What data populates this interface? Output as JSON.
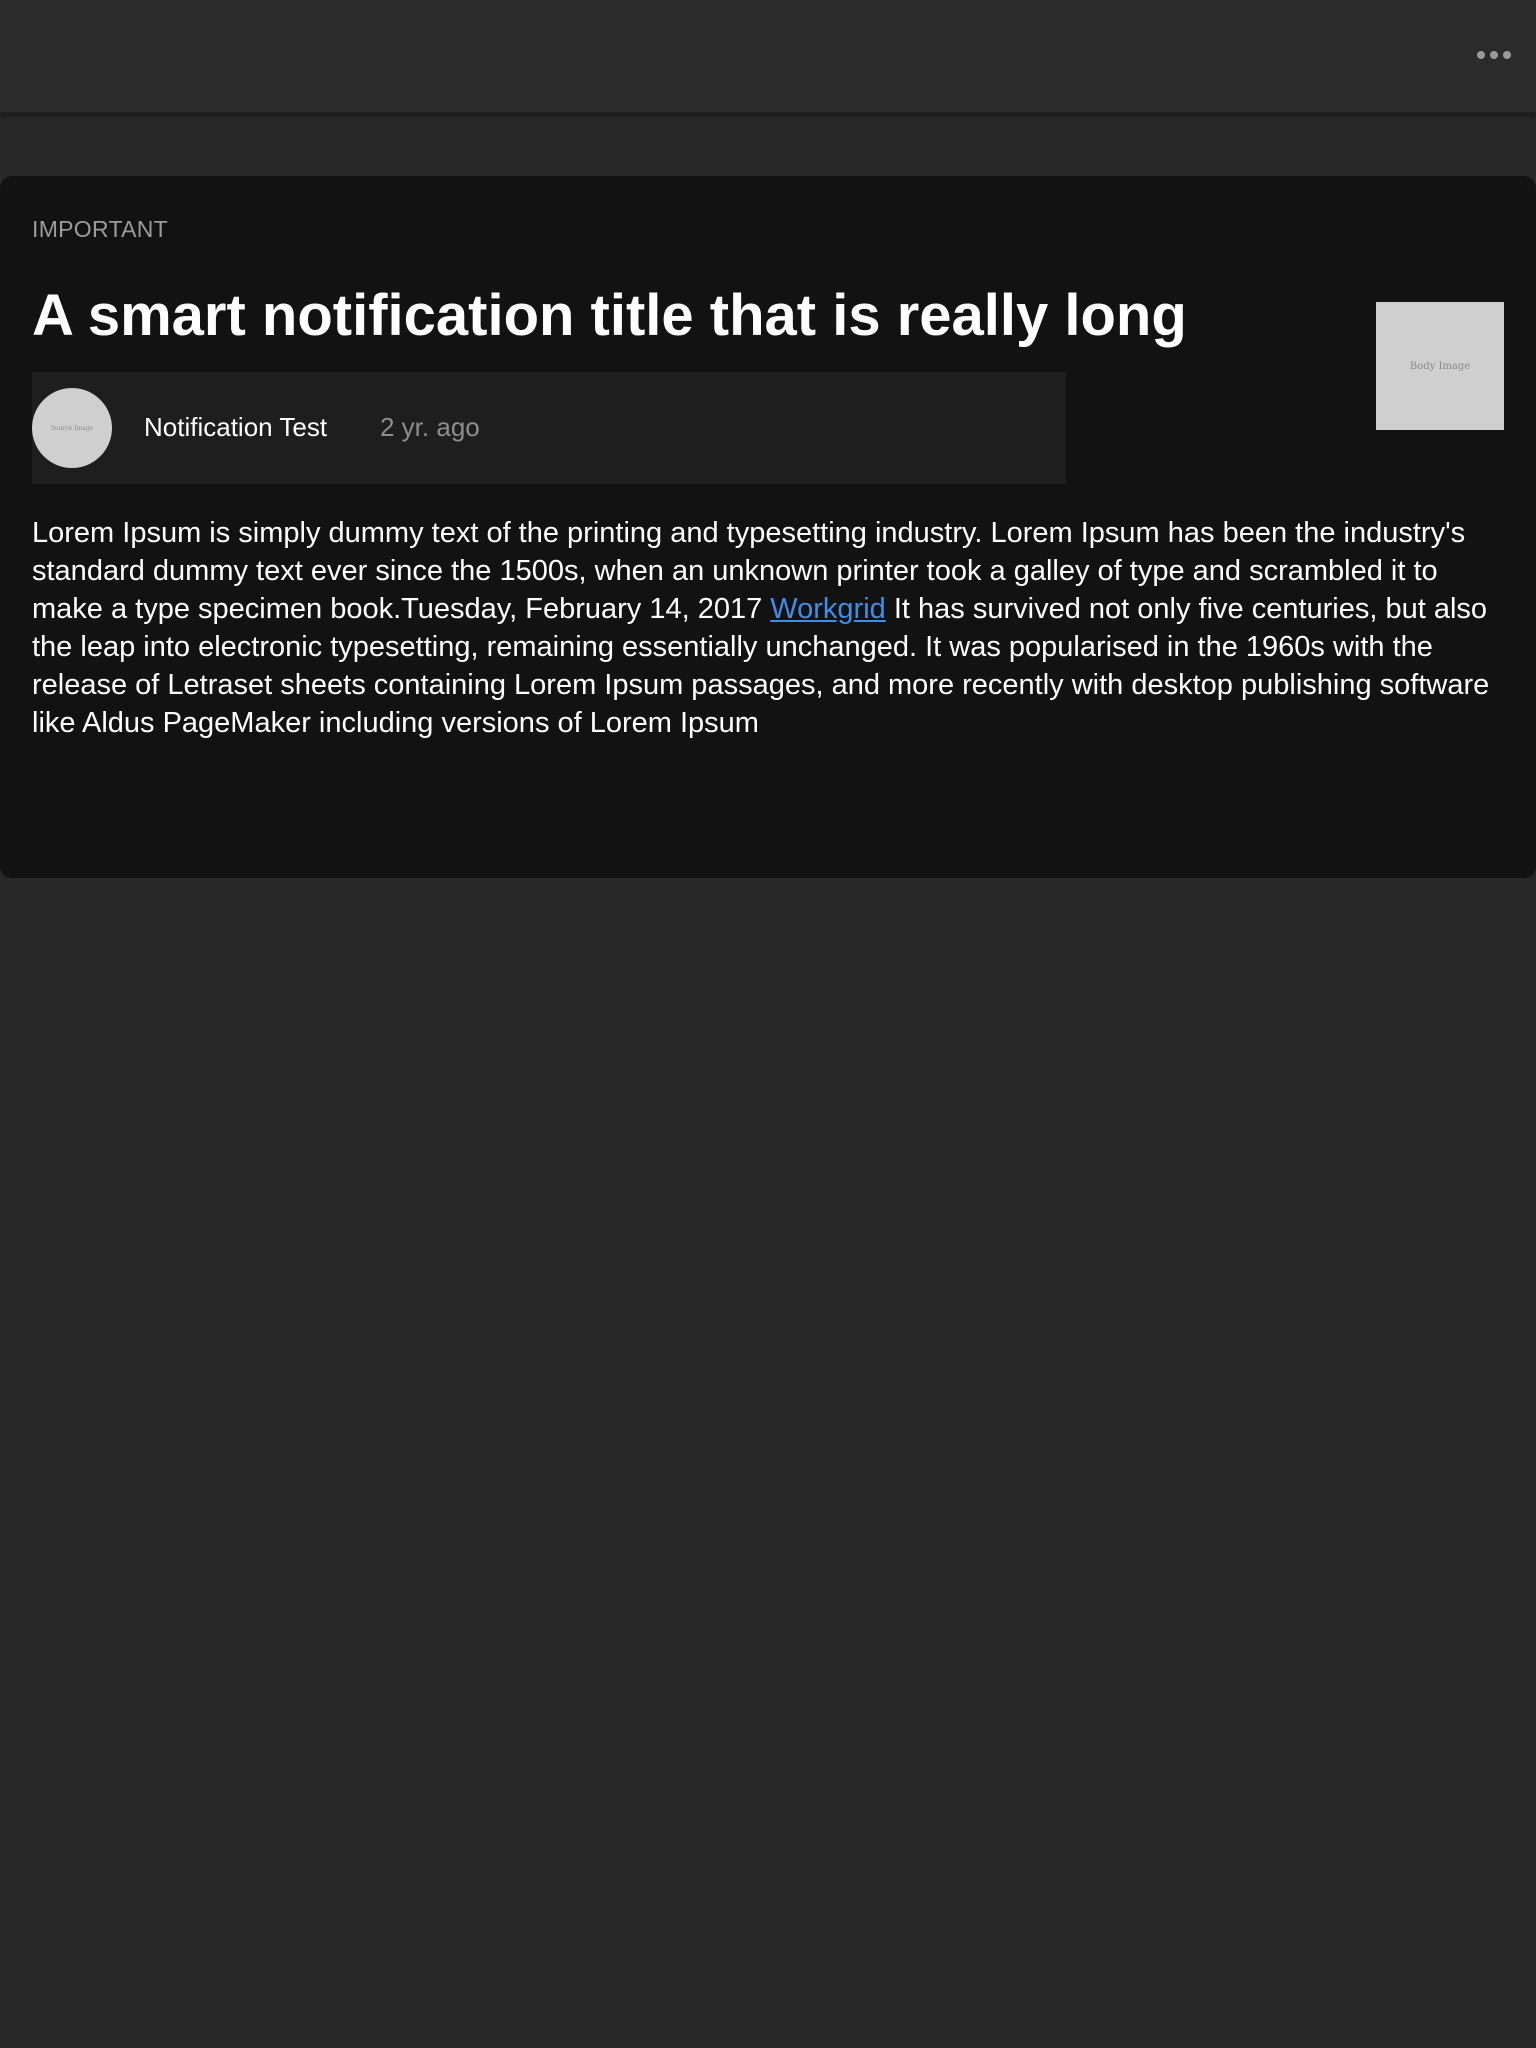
{
  "header": {
    "more_icon": "more-horizontal-icon"
  },
  "notification": {
    "category": "IMPORTANT",
    "title": "A smart notification title that is really long",
    "source": {
      "avatar_alt": "Source Image",
      "name": "Notification Test",
      "time": "2 yr. ago"
    },
    "body_image_alt": "Body Image",
    "body": {
      "text_before_link": "Lorem Ipsum is simply dummy text of the printing and typesetting industry. Lorem Ipsum has been the industry's standard dummy text ever since the 1500s, when an unknown printer took a galley of type and scrambled it to make a type specimen book.Tuesday, February 14, 2017 ",
      "link_text": "Workgrid",
      "text_after_link": " It has survived not only five centuries, but also the leap into electronic typesetting, remaining essentially unchanged. It was popularised in the 1960s with the release of Letraset sheets containing Lorem Ipsum passages, and more recently with desktop publishing software like Aldus PageMaker including versions of Lorem Ipsum"
    }
  },
  "colors": {
    "background": "#282828",
    "card": "#121212",
    "source_row": "#1e1e1e",
    "link": "#3d8fe6",
    "muted_text": "#9b9b9b"
  }
}
